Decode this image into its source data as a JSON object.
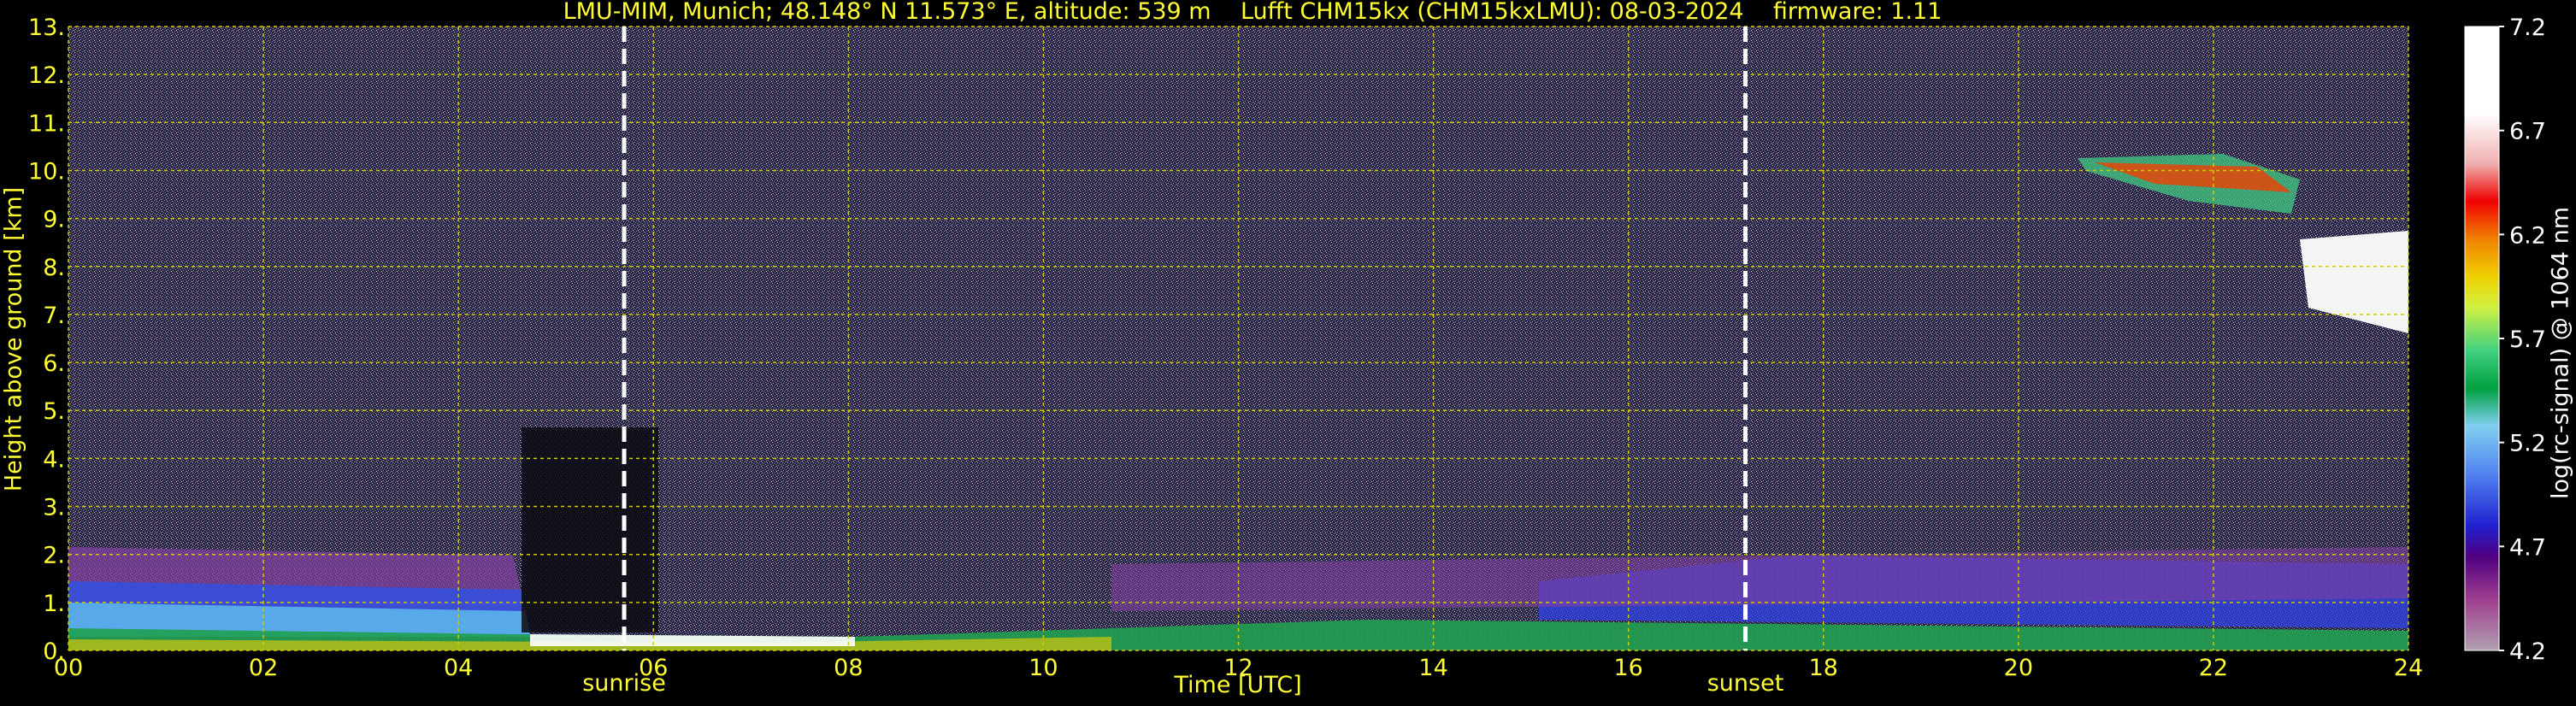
{
  "title": "LMU-MIM, Munich; 48.148° N 11.573° E, altitude: 539 m    Lufft CHM15kx (CHM15kxLMU): 08-03-2024    firmware: 1.11",
  "chart_data": {
    "type": "heatmap",
    "xlabel": "Time [UTC]",
    "ylabel": "Height above ground [km]",
    "xlim": [
      0,
      24
    ],
    "ylim": [
      0,
      13
    ],
    "x_ticks": [
      "00",
      "02",
      "04",
      "06",
      "08",
      "10",
      "12",
      "14",
      "16",
      "18",
      "20",
      "22",
      "24"
    ],
    "y_ticks": [
      "0.",
      "1.",
      "2.",
      "3.",
      "4.",
      "5.",
      "6.",
      "7.",
      "8.",
      "9.",
      "10.",
      "11.",
      "12.",
      "13."
    ],
    "grid": true,
    "colorbar": {
      "label": "log(rc-signal) @ 1064 nm",
      "range": [
        4.2,
        7.2
      ],
      "ticks": [
        "7.2",
        "6.7",
        "6.2",
        "5.7",
        "5.2",
        "4.7",
        "4.2"
      ]
    },
    "events": [
      {
        "name": "sunrise",
        "time": 5.7
      },
      {
        "name": "sunset",
        "time": 17.2
      }
    ],
    "colors": {
      "text": "#ffff33",
      "grid": "#cccc00",
      "event_line": "#ffffff"
    }
  }
}
